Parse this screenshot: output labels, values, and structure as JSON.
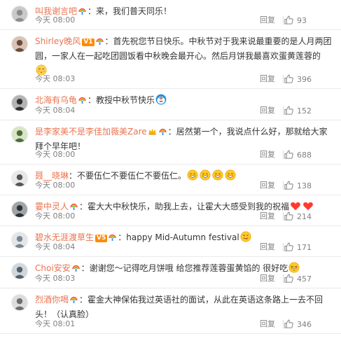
{
  "actions": {
    "reply_label": "回复"
  },
  "comments": [
    {
      "user": "叫我谢言吧",
      "badges": [
        "rainbow-badge"
      ],
      "vip": "",
      "text": "：来，我们普天同乐！",
      "emojis": [],
      "time": "今天 08:00",
      "likes": "93"
    },
    {
      "user": "Shirley晚风",
      "badges": [
        "vip-badge",
        "rainbow-badge"
      ],
      "vip": "V1",
      "text": "：首先祝您节日快乐。中秋节对于我来说最重要的是人月两团圆，一家人在一起吃团圆饭看中秋晚会最开心。然后月饼我最喜欢蛋黄莲蓉的",
      "emojis": [
        "blush-emoji"
      ],
      "time": "今天 08:03",
      "likes": "396"
    },
    {
      "user": "北海有乌龟",
      "badges": [
        "rainbow-badge"
      ],
      "vip": "",
      "text": "：教授中秋节快乐",
      "emojis": [
        "doraemon-emoji"
      ],
      "time": "今天 08:04",
      "likes": "152"
    },
    {
      "user": "是李家美不是李佳加薇美Zare",
      "badges": [
        "crown-badge",
        "rainbow-badge"
      ],
      "vip": "",
      "text": "：居然第一个，我说点什么好，那就给大家拜个早年吧！",
      "emojis": [],
      "time": "今天 08:00",
      "likes": "688"
    },
    {
      "user": "聂__晓琳",
      "badges": [],
      "vip": "",
      "text": "：不要伍仁不要伍仁不要伍仁。",
      "emojis": [
        "grin-emoji",
        "grin-emoji",
        "grin-emoji",
        "grin-emoji"
      ],
      "time": "今天 08:00",
      "likes": "138"
    },
    {
      "user": "霎中灵人",
      "badges": [
        "rainbow-badge"
      ],
      "vip": "",
      "text": "：霍大大中秋快乐，助我上去，让霍大大感受到我的祝福",
      "emojis": [
        "heart-emoji",
        "heart-emoji"
      ],
      "time": "今天 08:00",
      "likes": "214"
    },
    {
      "user": "碧水无涯渡草生",
      "badges": [
        "vip-badge",
        "rainbow-badge"
      ],
      "vip": "V5",
      "text": "：happy Mid-Autumn festival",
      "emojis": [
        "wink-tongue-emoji"
      ],
      "time": "今天 08:04",
      "likes": "171"
    },
    {
      "user": "Choi安安",
      "badges": [
        "rainbow-badge"
      ],
      "vip": "",
      "text": "：谢谢您～记得吃月饼哦 给您推荐莲蓉蛋黄馅的 很好吃",
      "emojis": [
        "laugh-emoji"
      ],
      "time": "今天 08:03",
      "likes": "457"
    },
    {
      "user": "烈酒你喝",
      "badges": [
        "rainbow-badge"
      ],
      "vip": "",
      "text": "：霍金大神保佑我过英语社的面试，从此在英语这条路上一去不回头！（认真脸）",
      "emojis": [],
      "time": "今天 08:01",
      "likes": "346"
    }
  ]
}
